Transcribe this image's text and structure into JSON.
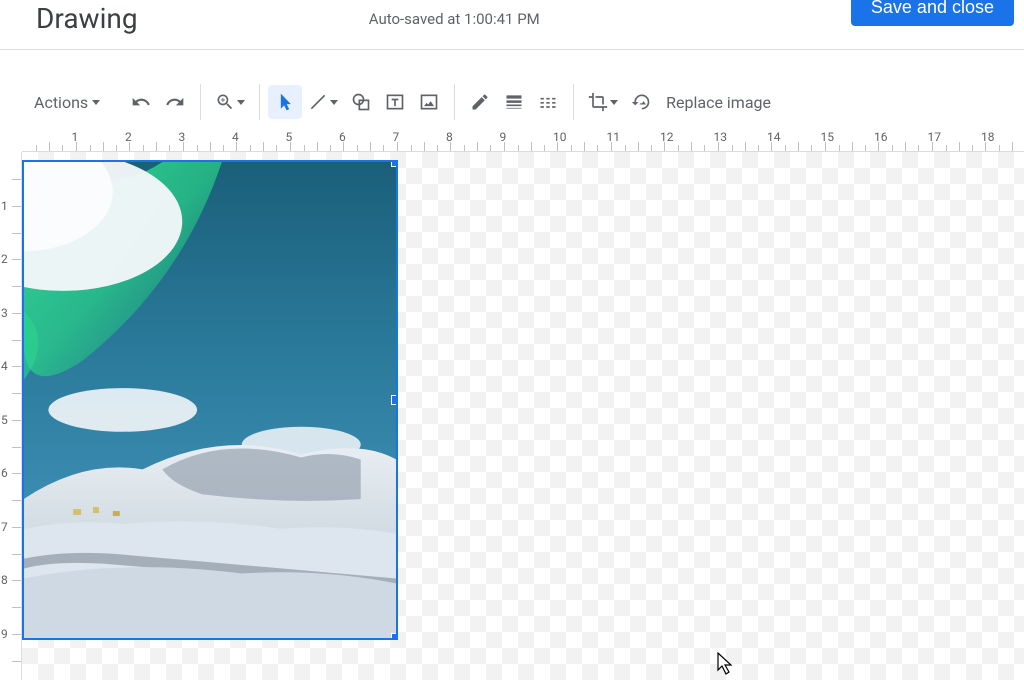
{
  "header": {
    "title": "Drawing",
    "status": "Auto-saved at 1:00:41 PM",
    "save_button": "Save and close"
  },
  "toolbar": {
    "actions_label": "Actions",
    "replace_image_label": "Replace image"
  },
  "ruler": {
    "h": [
      "",
      "1",
      "2",
      "3",
      "4",
      "5",
      "6",
      "7",
      "8",
      "9",
      "10",
      "11",
      "12",
      "13",
      "14",
      "15",
      "16",
      "17",
      "18"
    ],
    "v": [
      "",
      "1",
      "2",
      "3",
      "4",
      "5",
      "6",
      "7",
      "8",
      "9"
    ]
  },
  "selection": {
    "image_description": "aurora-over-snowy-mountains"
  }
}
